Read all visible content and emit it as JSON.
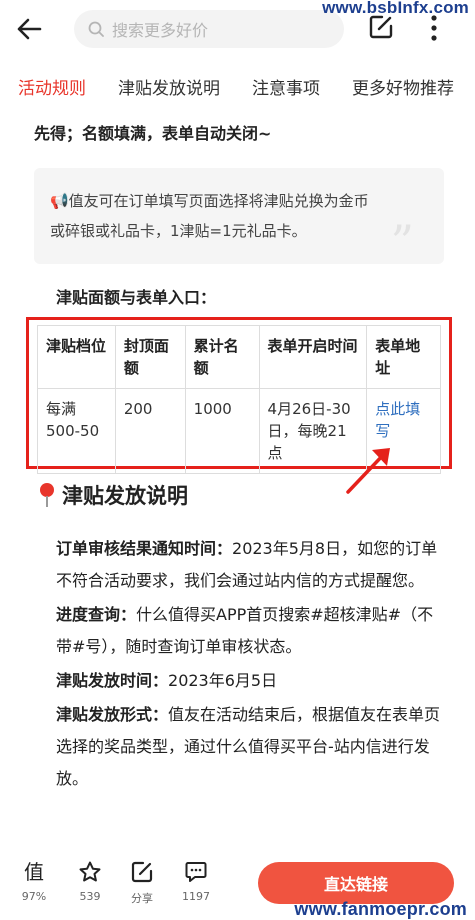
{
  "watermarks": {
    "top": "www.bsbInfx.com",
    "bottom": "www.fanmoepr.com"
  },
  "topbar": {
    "search_placeholder": "搜索更多好价",
    "icons": {
      "back": "back-arrow-icon",
      "search": "search-icon",
      "edit": "edit-icon",
      "more": "more-icon"
    }
  },
  "tabs": [
    {
      "label": "活动规则"
    },
    {
      "label": "津贴发放说明"
    },
    {
      "label": "注意事项"
    },
    {
      "label": "更多好物推荐"
    }
  ],
  "content": {
    "lead": "先得；名额填满，表单自动关闭~",
    "notice_line1": "📢值友可在订单填写页面选择将津贴兑换为金币",
    "notice_line2": "或碎银或礼品卡，1津贴=1元礼品卡。",
    "table_title": "津贴面额与表单入口：",
    "table": {
      "headers": [
        "津贴档位",
        "封顶面额",
        "累计名额",
        "表单开启时间",
        "表单地址"
      ],
      "rows": [
        [
          "每满500-50",
          "200",
          "1000",
          "4月26日-30日，每晚21点",
          "点此填写"
        ]
      ]
    },
    "section_title": "津贴发放说明",
    "paragraphs": [
      {
        "label": "订单审核结果通知时间：",
        "text": "2023年5月8日，如您的订单不符合活动要求，我们会通过站内信的方式提醒您。"
      },
      {
        "label": "进度查询：",
        "text": "什么值得买APP首页搜索#超核津贴#（不带#号），随时查询订单审核状态。"
      },
      {
        "label": "津贴发放时间：",
        "text": "2023年6月5日"
      },
      {
        "label": "津贴发放形式：",
        "text": "值友在活动结束后，根据值友在表单页选择的奖品类型，通过什么值得买平台-站内信进行发放。"
      }
    ]
  },
  "bottombar": {
    "worth": {
      "icon": "worth-icon",
      "label": "97%"
    },
    "favorite": {
      "icon": "star-icon",
      "label": "539"
    },
    "share": {
      "icon": "share-icon",
      "label": "分享"
    },
    "comment": {
      "icon": "comment-icon",
      "label": "1197"
    },
    "buy_label": "直达链接"
  },
  "colors": {
    "accent": "#e8352b",
    "table_border": "#e5211b",
    "link": "#2f6fbf",
    "buy_button": "#f05440"
  }
}
